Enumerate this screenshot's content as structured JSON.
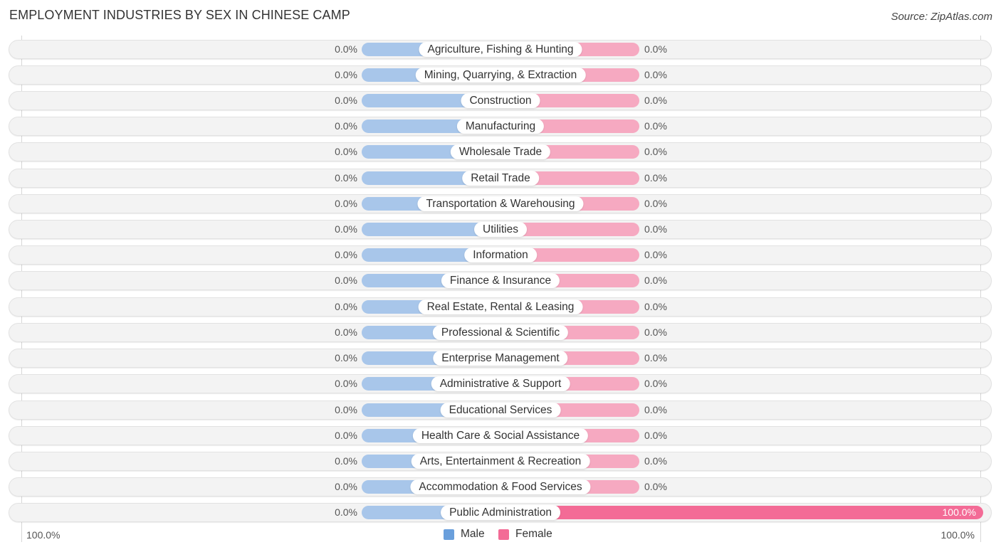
{
  "header": {
    "title": "EMPLOYMENT INDUSTRIES BY SEX IN CHINESE CAMP",
    "source": "Source: ZipAtlas.com"
  },
  "colors": {
    "male": "#a8c6ea",
    "male_legend": "#6a9fdc",
    "female": "#f6a9c1",
    "female_full": "#f36b96",
    "row_bg": "#f3f3f3"
  },
  "chart_data": {
    "type": "bar",
    "orientation": "horizontal-diverging",
    "title": "EMPLOYMENT INDUSTRIES BY SEX IN CHINESE CAMP",
    "categories": [
      "Agriculture, Fishing & Hunting",
      "Mining, Quarrying, & Extraction",
      "Construction",
      "Manufacturing",
      "Wholesale Trade",
      "Retail Trade",
      "Transportation & Warehousing",
      "Utilities",
      "Information",
      "Finance & Insurance",
      "Real Estate, Rental & Leasing",
      "Professional & Scientific",
      "Enterprise Management",
      "Administrative & Support",
      "Educational Services",
      "Health Care & Social Assistance",
      "Arts, Entertainment & Recreation",
      "Accommodation & Food Services",
      "Public Administration"
    ],
    "series": [
      {
        "name": "Male",
        "values": [
          0,
          0,
          0,
          0,
          0,
          0,
          0,
          0,
          0,
          0,
          0,
          0,
          0,
          0,
          0,
          0,
          0,
          0,
          0
        ]
      },
      {
        "name": "Female",
        "values": [
          0,
          0,
          0,
          0,
          0,
          0,
          0,
          0,
          0,
          0,
          0,
          0,
          0,
          0,
          0,
          0,
          0,
          0,
          100
        ]
      }
    ],
    "value_labels": {
      "male": [
        "0.0%",
        "0.0%",
        "0.0%",
        "0.0%",
        "0.0%",
        "0.0%",
        "0.0%",
        "0.0%",
        "0.0%",
        "0.0%",
        "0.0%",
        "0.0%",
        "0.0%",
        "0.0%",
        "0.0%",
        "0.0%",
        "0.0%",
        "0.0%",
        "0.0%"
      ],
      "female": [
        "0.0%",
        "0.0%",
        "0.0%",
        "0.0%",
        "0.0%",
        "0.0%",
        "0.0%",
        "0.0%",
        "0.0%",
        "0.0%",
        "0.0%",
        "0.0%",
        "0.0%",
        "0.0%",
        "0.0%",
        "0.0%",
        "0.0%",
        "0.0%",
        "100.0%"
      ]
    },
    "unit": "%",
    "xlim": [
      -100,
      100
    ],
    "axis_labels": {
      "left": "100.0%",
      "right": "100.0%"
    },
    "legend": {
      "placement": "bottom-center",
      "entries": [
        "Male",
        "Female"
      ]
    }
  }
}
